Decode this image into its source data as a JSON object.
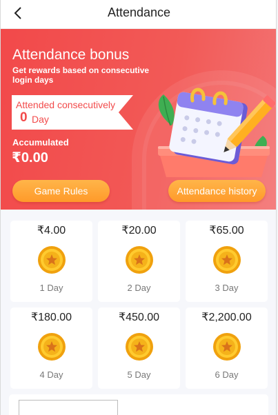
{
  "header": {
    "title": "Attendance",
    "back_icon": "chevron-left-icon"
  },
  "hero": {
    "title": "Attendance bonus",
    "subtitle": "Get rewards based on consecutive login days",
    "ribbon_label": "Attended consecutively",
    "consecutive_days": "0",
    "days_unit": "Day",
    "accumulated_label": "Accumulated",
    "accumulated_value": "₹0.00",
    "rules_button": "Game Rules",
    "history_button": "Attendance history",
    "illustration": "calendar-pencil-illustration"
  },
  "rewards": [
    {
      "amount": "₹4.00",
      "day": "1 Day"
    },
    {
      "amount": "₹20.00",
      "day": "2 Day"
    },
    {
      "amount": "₹65.00",
      "day": "3 Day"
    },
    {
      "amount": "₹180.00",
      "day": "4 Day"
    },
    {
      "amount": "₹450.00",
      "day": "5 Day"
    },
    {
      "amount": "₹2,200.00",
      "day": "6 Day"
    }
  ],
  "colors": {
    "hero_red": "#f2494a",
    "button_orange": "#ff9a2a",
    "coin_gold": "#f5b21a"
  }
}
